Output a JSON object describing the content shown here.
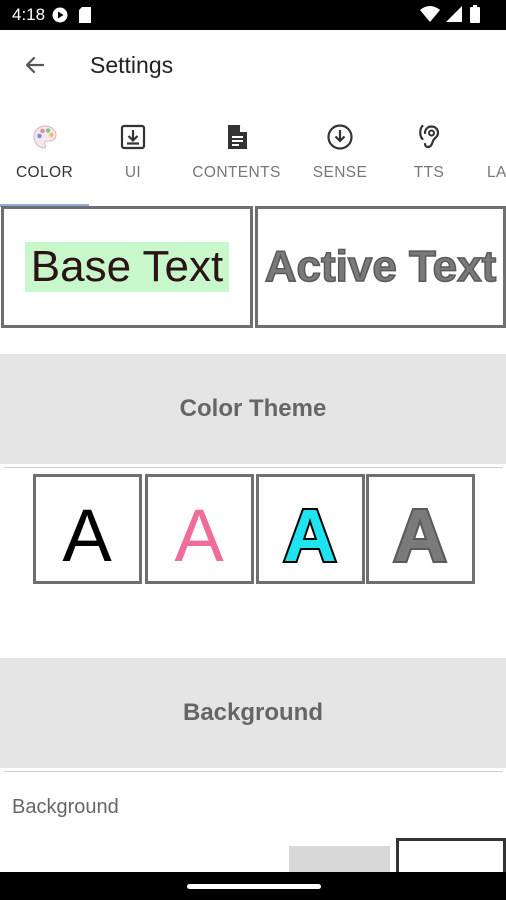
{
  "status_bar": {
    "time": "4:18",
    "icons": [
      "play-store-icon",
      "sd-card-icon",
      "wifi-icon",
      "signal-icon",
      "battery-icon"
    ]
  },
  "app_bar": {
    "title": "Settings",
    "back_icon": "arrow-back-icon"
  },
  "tabs": [
    {
      "label": "COLOR",
      "icon": "palette-icon",
      "active": true
    },
    {
      "label": "UI",
      "icon": "download-box-icon",
      "active": false
    },
    {
      "label": "CONTENTS",
      "icon": "document-icon",
      "active": false
    },
    {
      "label": "SENSE",
      "icon": "download-circle-icon",
      "active": false
    },
    {
      "label": "TTS",
      "icon": "hearing-icon",
      "active": false
    },
    {
      "label": "LA",
      "icon": "",
      "active": false
    }
  ],
  "preview": {
    "base_text": "Base Text",
    "active_text": "Active Text"
  },
  "sections": {
    "color_theme": "Color Theme",
    "background": "Background"
  },
  "color_themes": [
    {
      "letter": "A",
      "fill": "#000000",
      "stroke": "none"
    },
    {
      "letter": "A",
      "fill": "#f06c9b",
      "stroke": "none"
    },
    {
      "letter": "A",
      "fill": "#1ee3f0",
      "stroke": "#000000"
    },
    {
      "letter": "A",
      "fill": "#7a7a7a",
      "stroke": "#5a5a5a"
    }
  ],
  "background": {
    "label": "Background",
    "swatches": [
      "#d8d8d8",
      "#ffffff"
    ]
  }
}
